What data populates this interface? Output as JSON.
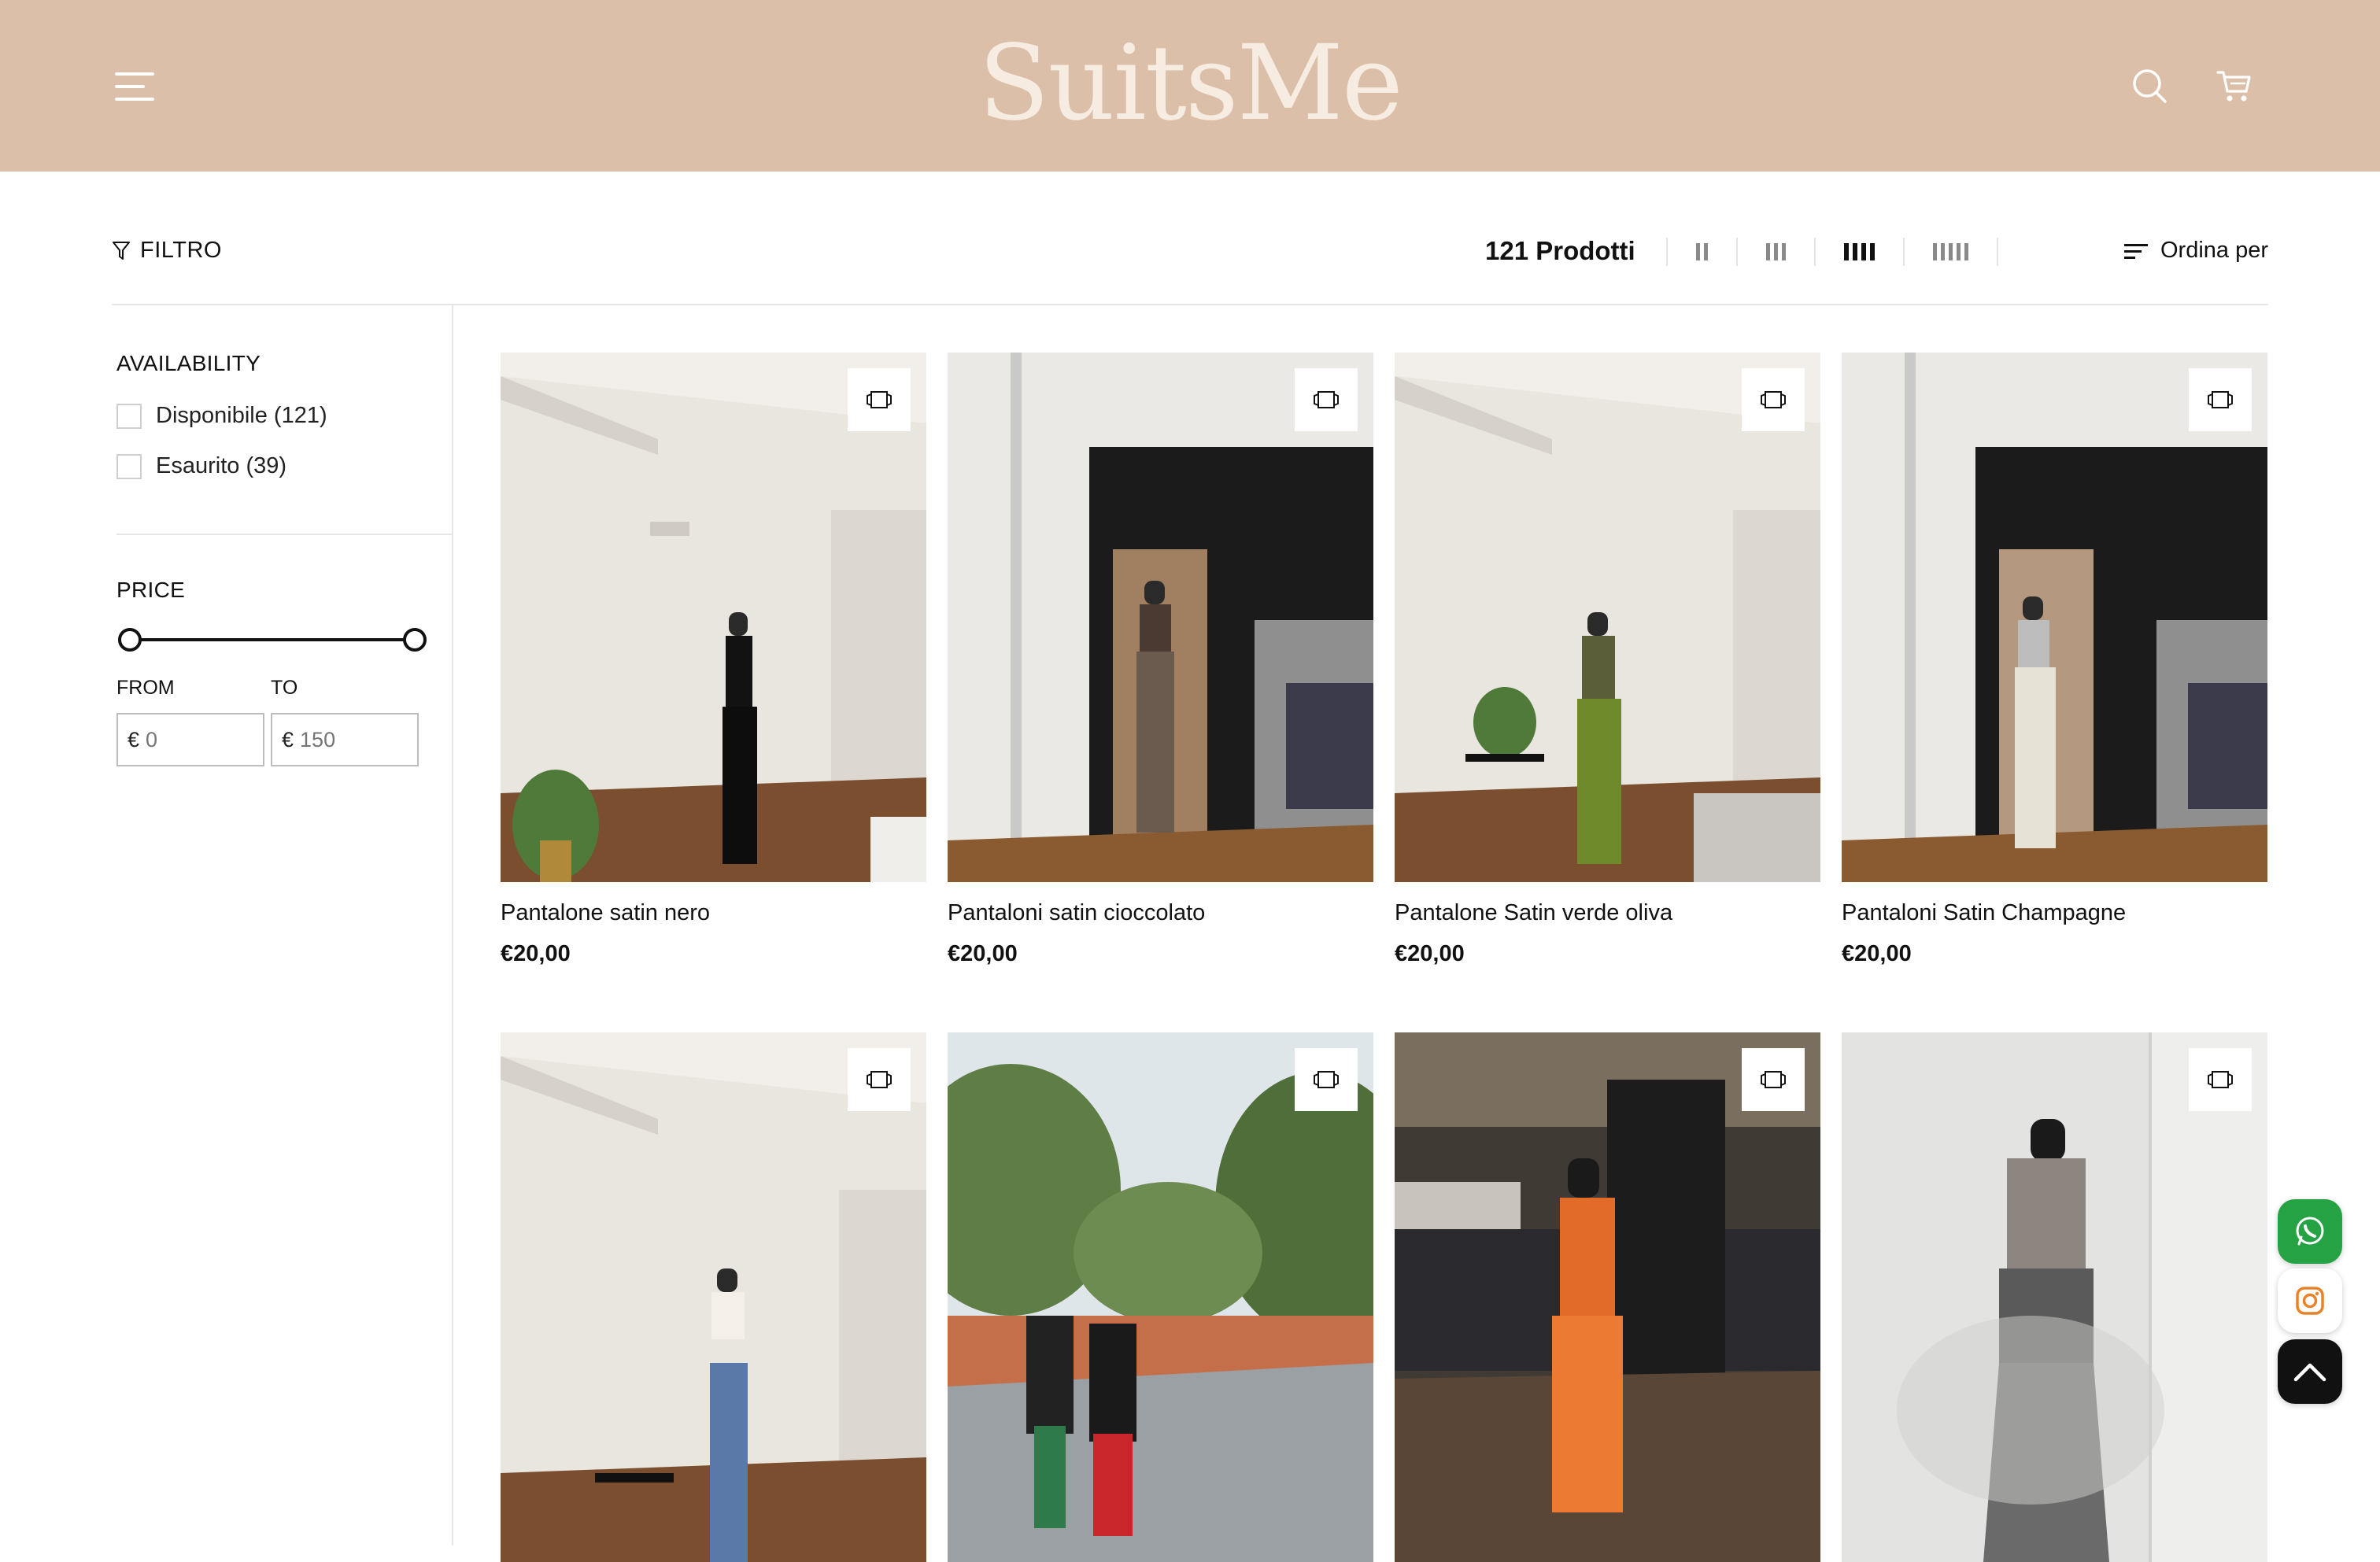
{
  "header": {
    "logo": "SuitsMe",
    "menu_icon": "hamburger-menu-icon",
    "search_icon": "search-icon",
    "cart_icon": "cart-icon",
    "bg_color": "#dcbfa8"
  },
  "toolbar": {
    "filter_label": "FILTRO",
    "product_count": "121 Prodotti",
    "view_options": [
      {
        "name": "2-columns",
        "active": false
      },
      {
        "name": "3-columns",
        "active": false
      },
      {
        "name": "4-columns",
        "active": true
      },
      {
        "name": "5-columns",
        "active": false
      }
    ],
    "sort_label": "Ordina per"
  },
  "sidebar": {
    "availability": {
      "title": "AVAILABILITY",
      "options": [
        {
          "label": "Disponibile (121)",
          "checked": false
        },
        {
          "label": "Esaurito (39)",
          "checked": false
        }
      ]
    },
    "price": {
      "title": "PRICE",
      "from_label": "FROM",
      "to_label": "TO",
      "currency": "€",
      "from_placeholder": "0",
      "to_placeholder": "150",
      "range_min": 0,
      "range_max": 150
    }
  },
  "products": [
    {
      "name": "Pantalone satin nero",
      "price": "€20,00"
    },
    {
      "name": "Pantaloni satin cioccolato",
      "price": "€20,00"
    },
    {
      "name": "Pantalone Satin verde oliva",
      "price": "€20,00"
    },
    {
      "name": "Pantaloni Satin Champagne",
      "price": "€20,00"
    },
    {
      "name": "",
      "price": ""
    },
    {
      "name": "",
      "price": ""
    },
    {
      "name": "",
      "price": ""
    },
    {
      "name": "",
      "price": ""
    }
  ],
  "floating": {
    "whatsapp_color": "#25a244",
    "instagram_color": "#e8832a",
    "scroll_top_color": "#111111"
  }
}
